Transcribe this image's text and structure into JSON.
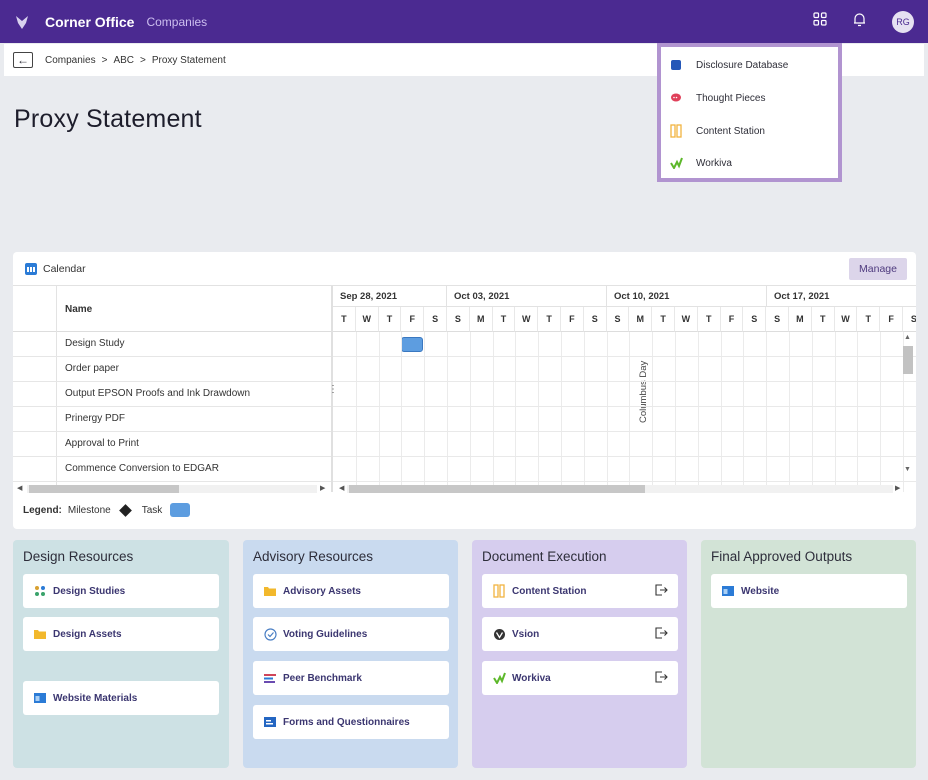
{
  "topbar": {
    "brand": "Corner Office",
    "nav_link": "Companies",
    "avatar_initials": "RG",
    "color": "#4b2a91"
  },
  "breadcrumb": {
    "back_icon": "arrow-left-icon",
    "items": [
      "Companies",
      ">",
      "ABC",
      ">",
      "Proxy Statement"
    ]
  },
  "page": {
    "title": "Proxy Statement"
  },
  "apps_menu": {
    "items": [
      {
        "label": "Disclosure Database",
        "icon": "database-icon"
      },
      {
        "label": "Thought Pieces",
        "icon": "chat-bubble-icon"
      },
      {
        "label": "Content Station",
        "icon": "columns-icon"
      },
      {
        "label": "Workiva",
        "icon": "workiva-check-icon"
      }
    ]
  },
  "calendar": {
    "title": "Calendar",
    "manage_label": "Manage",
    "name_header": "Name",
    "tasks": [
      "Design Study",
      "Order paper",
      "Output EPSON Proofs and Ink Drawdown",
      "Prinergy PDF",
      "Approval to Print",
      "Commence Conversion to EDGAR"
    ],
    "weeks": [
      "Sep 28, 2021",
      "Oct 03, 2021",
      "Oct 10, 2021",
      "Oct 17, 2021"
    ],
    "days": [
      "T",
      "W",
      "T",
      "F",
      "S",
      "S",
      "M",
      "T",
      "W",
      "T",
      "F",
      "S",
      "S",
      "M",
      "T",
      "W",
      "T",
      "F",
      "S",
      "S",
      "M",
      "T",
      "W",
      "T",
      "F",
      "S"
    ],
    "holiday": "Columbus Day",
    "legend": {
      "label": "Legend:",
      "milestone": "Milestone",
      "task": "Task"
    },
    "task_color": "#5d9de0"
  },
  "resources": [
    {
      "title": "Design Resources",
      "bg": "#cde1e4",
      "items": [
        {
          "label": "Design Studies",
          "icon": "dots-grid-icon"
        },
        {
          "label": "Design Assets",
          "icon": "folder-icon"
        },
        {
          "label": "Website Materials",
          "icon": "browser-icon"
        }
      ]
    },
    {
      "title": "Advisory Resources",
      "bg": "#c9daef",
      "items": [
        {
          "label": "Advisory Assets",
          "icon": "folder-icon"
        },
        {
          "label": "Voting Guidelines",
          "icon": "check-circle-icon"
        },
        {
          "label": "Peer Benchmark",
          "icon": "bars-icon"
        },
        {
          "label": "Forms and Questionnaires",
          "icon": "form-icon"
        }
      ]
    },
    {
      "title": "Document Execution",
      "bg": "#d6cdee",
      "items": [
        {
          "label": "Content Station",
          "icon": "columns-icon"
        },
        {
          "label": "Vsion",
          "icon": "vsion-icon"
        },
        {
          "label": "Workiva",
          "icon": "workiva-check-icon"
        }
      ]
    },
    {
      "title": "Final Approved Outputs",
      "bg": "#d2e3d6",
      "items": [
        {
          "label": "Website",
          "icon": "browser-icon"
        }
      ]
    }
  ]
}
